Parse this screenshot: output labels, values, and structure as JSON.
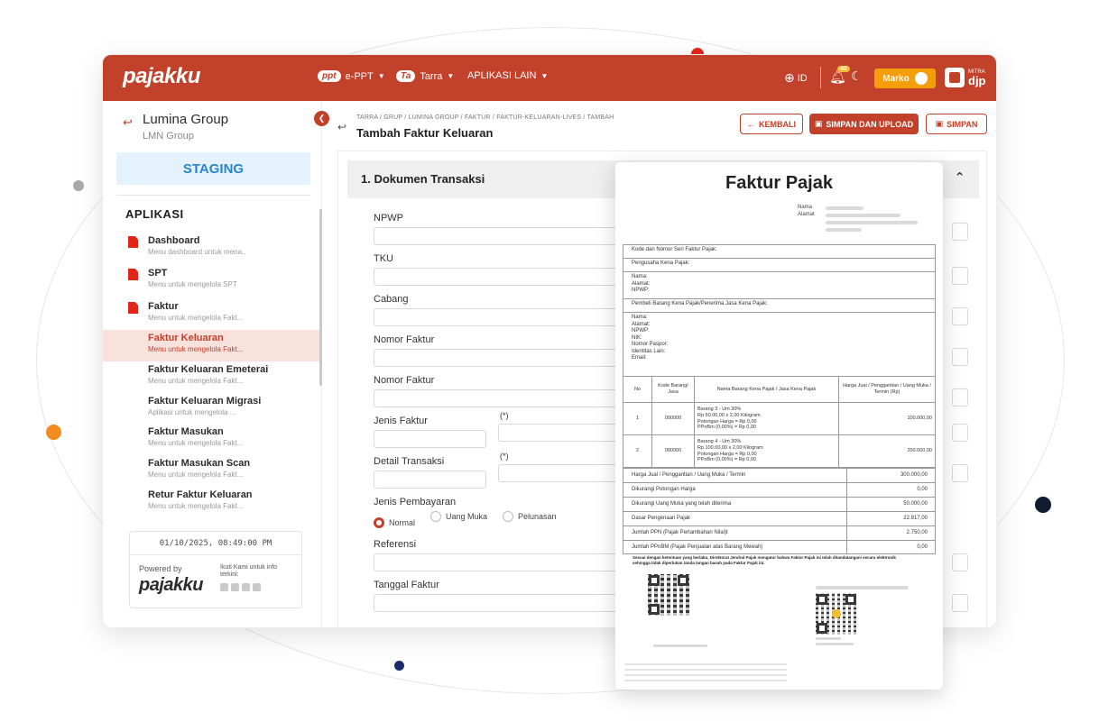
{
  "app": {
    "logo": "pajakku"
  },
  "topnav": {
    "eppt_pill": "ppt",
    "eppt_label": "e-PPT",
    "tarra_pill": "Ta",
    "tarra_label": "Tarra",
    "aplikasi_label": "APLIKASI LAIN",
    "lang": "ID",
    "notif_count": "40",
    "user": "Marko",
    "mitra_small": "MITRA",
    "mitra_big": "djp"
  },
  "sidebar": {
    "org_name": "Lumina Group",
    "org_sub": "LMN Group",
    "env": "STAGING",
    "section": "APLIKASI",
    "items": [
      {
        "title": "Dashboard",
        "desc": "Menu dashboard untuk mena..",
        "icon": true
      },
      {
        "title": "SPT",
        "desc": "Menu untuk mengelola SPT",
        "icon": true
      },
      {
        "title": "Faktur",
        "desc": "Menu untuk mengelola Fakt...",
        "icon": true
      },
      {
        "title": "Faktur Keluaran",
        "desc": "Menu untuk mengelola Fakt...",
        "active": true
      },
      {
        "title": "Faktur Keluaran Emeterai",
        "desc": "Menu untuk mengelola Fakt..."
      },
      {
        "title": "Faktur Keluaran Migrasi",
        "desc": "Aplikasi untuk mengelola ..."
      },
      {
        "title": "Faktur Masukan",
        "desc": "Menu untuk mengelola Fakt..."
      },
      {
        "title": "Faktur Masukan Scan",
        "desc": "Menu untuk mengelola Fakt..."
      },
      {
        "title": "Retur Faktur Keluaran",
        "desc": "Menu untuk mengelola Fakt..."
      }
    ],
    "datetime": "01/10/2025, 08:49:00 PM",
    "powered_by": "Powered by",
    "powered_logo": "pajakku",
    "follow": "Ikuti Kami untuk info terkini:"
  },
  "page": {
    "breadcrumb": "TARRA / GRUP / LUMINA GROUP / FAKTUR / FAKTUR-KELUARAN-LIVES / TAMBAH",
    "title": "Tambah Faktur Keluaran",
    "btn_back": "KEMBALI",
    "btn_save_upload": "SIMPAN DAN UPLOAD",
    "btn_save": "SIMPAN",
    "section_title": "1. Dokumen Transaksi",
    "fields": {
      "npwp": "NPWP",
      "tku": "TKU",
      "cabang": "Cabang",
      "nomor_faktur_1": "Nomor Faktur",
      "nomor_faktur_2": "Nomor Faktur",
      "jenis_faktur": "Jenis Faktur",
      "detail_transaksi": "Detail Transaksi",
      "jenis_pembayaran": "Jenis Pembayaran",
      "referensi": "Referensi",
      "tanggal_faktur": "Tanggal Faktur",
      "required_mark": "(*)"
    },
    "payment_options": [
      "Normal",
      "Uang Muka",
      "Pelunasan"
    ]
  },
  "invoice": {
    "title": "Faktur Pajak",
    "nama": "Nama",
    "alamat": "Alamat",
    "rows": {
      "kode_seri": "Kode dan Nomor Seri Faktur Pajak:",
      "pengusaha": "Pengusaha Kena Pajak:",
      "pengusaha_fields": [
        "Nama:",
        "Alamat:",
        "NPWP:"
      ],
      "pembeli": "Pembeli Barang Kena Pajak/Penerima Jasa Kena Pajak:",
      "pembeli_fields": [
        "Nama:",
        "Alamat:",
        "NPWP:",
        "NIK:",
        "Nomor Paspor:",
        "Identitas Lain:",
        "Email:"
      ]
    },
    "table_headers": [
      "No",
      "Kode Barang/ Jasa",
      "Nama Barang Kena Pajak / Jasa Kena Pajak",
      "Harga Jual / Penggantian / Uang Muka / Termin (Rp)"
    ],
    "items": [
      {
        "no": "1",
        "kode": "000000",
        "lines": [
          "Barang 3 - Um 30%",
          "Rp 50.00,00 x 2,00 Kilogram",
          "Potongan Harga = Rp 0,00",
          "PPnBm (0,00%) = Rp 0,00"
        ],
        "harga": "100.000,00"
      },
      {
        "no": "2",
        "kode": "000000",
        "lines": [
          "Barang 4 - Um 30%",
          "Rp 100.00,00 x 2,00 Kilogram",
          "Potongan Harga = Rp 0,00",
          "PPnBm (0,00%) = Rp 0,00"
        ],
        "harga": "200.000,00"
      }
    ],
    "summary": [
      {
        "label": "Harga Jual / Penggantian / Uang Muka / Termin",
        "value": "300.000,00"
      },
      {
        "label": "Dikurangi Potongan Harga",
        "value": "0,00"
      },
      {
        "label": "Dikurangi Uang Muka yang telah diterima",
        "value": "50.000,00"
      },
      {
        "label": "Dasar Pengenaan Pajak",
        "value": "22.917,00"
      },
      {
        "label": "Jumlah PPN (Pajak Pertambahan Nilai)t",
        "value": "2.750,00"
      },
      {
        "label": "Jumlah PPnBM (Pajak Penjualan atas Barang Mewah)",
        "value": "0,00"
      }
    ],
    "disclaimer": "Sesuai dengan ketentuan yang berlaku, Direktorat Jendral Pajak mengatur bahwa Faktur Pajak ini telah ditandatangani secara elektronik sehingga tidak diperlukan tanda tangan basah pada Faktur Pajak ini."
  },
  "colors": {
    "brand": "#c2412a",
    "accent": "#f59e0b",
    "staging_bg": "#e3f2fc",
    "staging_text": "#2a86c8"
  }
}
